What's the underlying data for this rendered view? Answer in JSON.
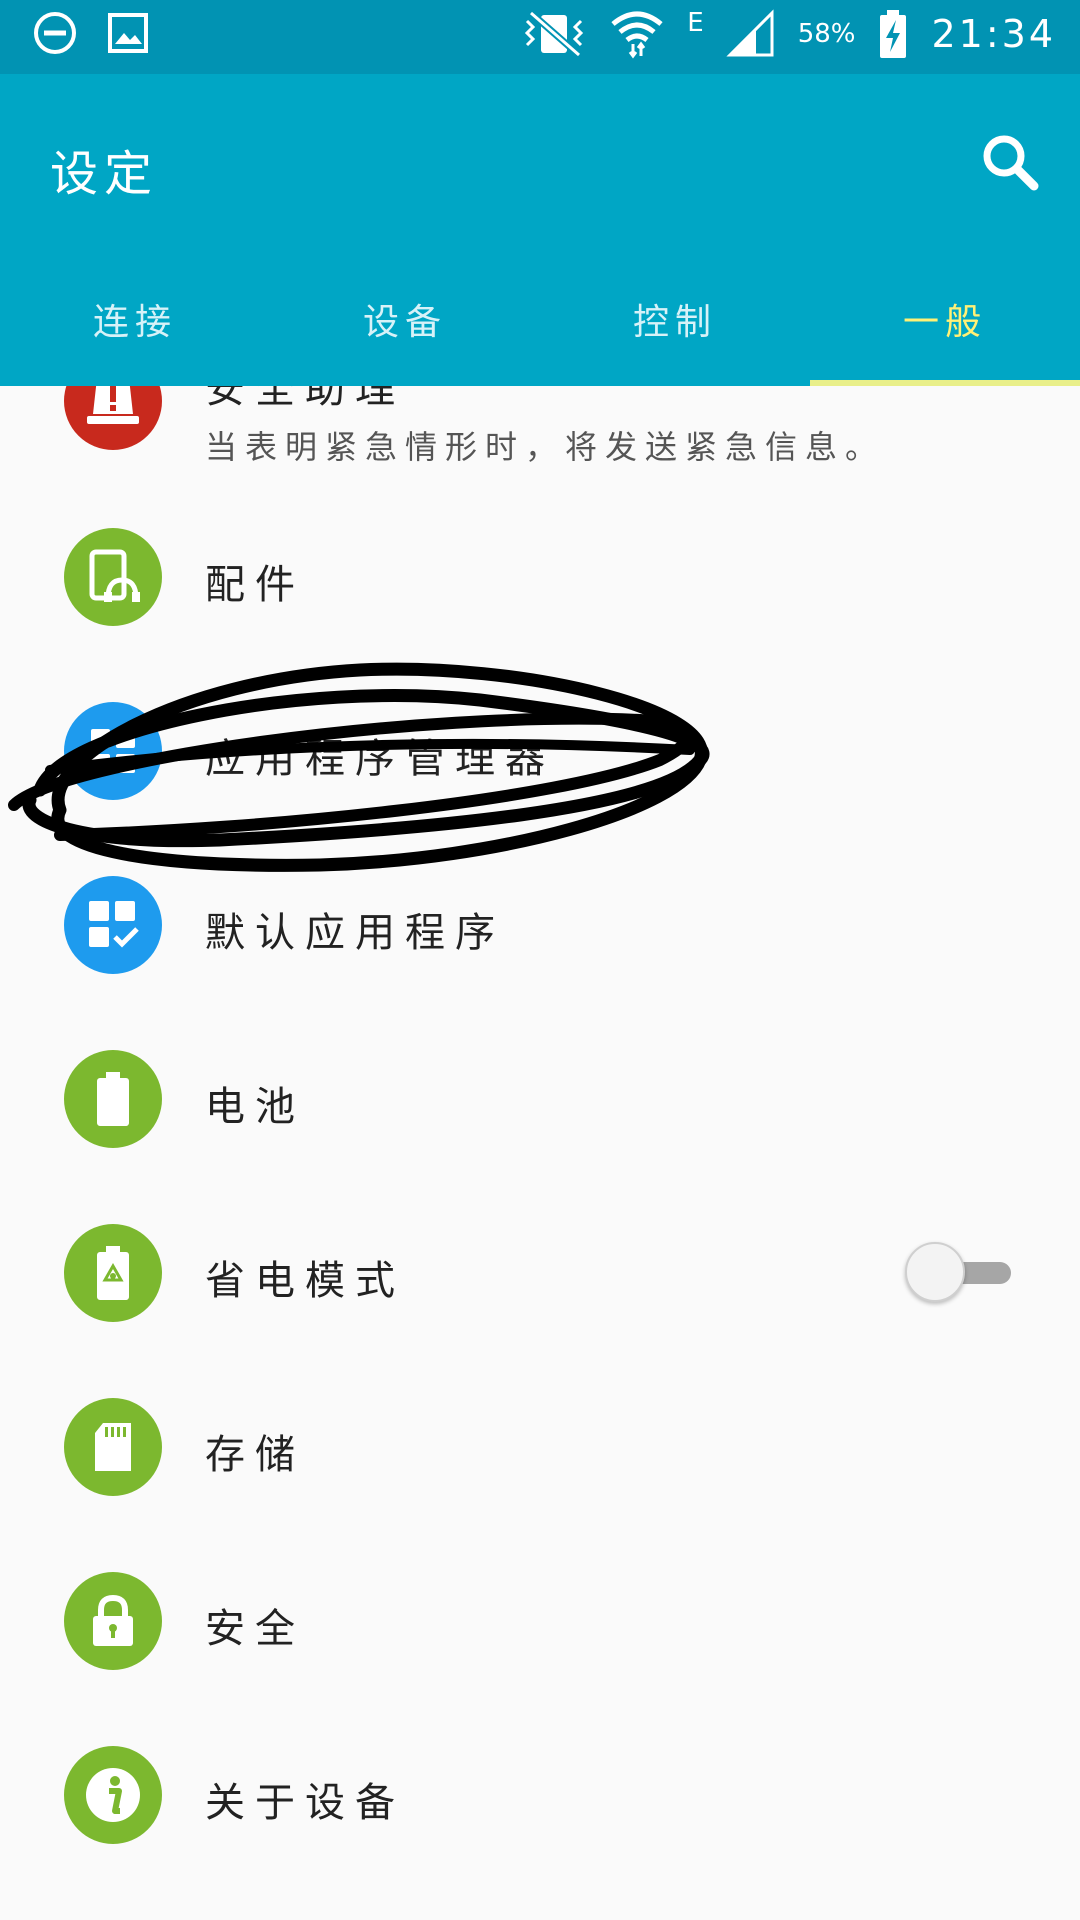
{
  "status_bar": {
    "signal_type": "E",
    "battery": "58%",
    "time": "21:34"
  },
  "header": {
    "title": "设定",
    "search_icon": "search-icon"
  },
  "tabs": [
    {
      "label": "连接"
    },
    {
      "label": "设备"
    },
    {
      "label": "控制"
    },
    {
      "label": "一般",
      "active": true
    }
  ],
  "settings": [
    {
      "label": "安全助理",
      "sub": "当表明紧急情形时，将发送紧急信息。",
      "icon": "alert-icon",
      "color": "#c8291d"
    },
    {
      "label": "配件",
      "icon": "accessory-icon",
      "color": "#7cb82f"
    },
    {
      "label": "应用程序管理器",
      "icon": "apps-icon",
      "color": "#1e9bee"
    },
    {
      "label": "默认应用程序",
      "icon": "default-apps-icon",
      "color": "#1e9bee"
    },
    {
      "label": "电池",
      "icon": "battery-icon",
      "color": "#7cb82f"
    },
    {
      "label": "省电模式",
      "icon": "power-saving-icon",
      "color": "#7cb82f",
      "toggle_on": false
    },
    {
      "label": "存储",
      "icon": "sd-card-icon",
      "color": "#7cb82f"
    },
    {
      "label": "安全",
      "icon": "lock-icon",
      "color": "#7cb82f"
    },
    {
      "label": "关于设备",
      "icon": "info-icon",
      "color": "#7cb82f"
    }
  ]
}
